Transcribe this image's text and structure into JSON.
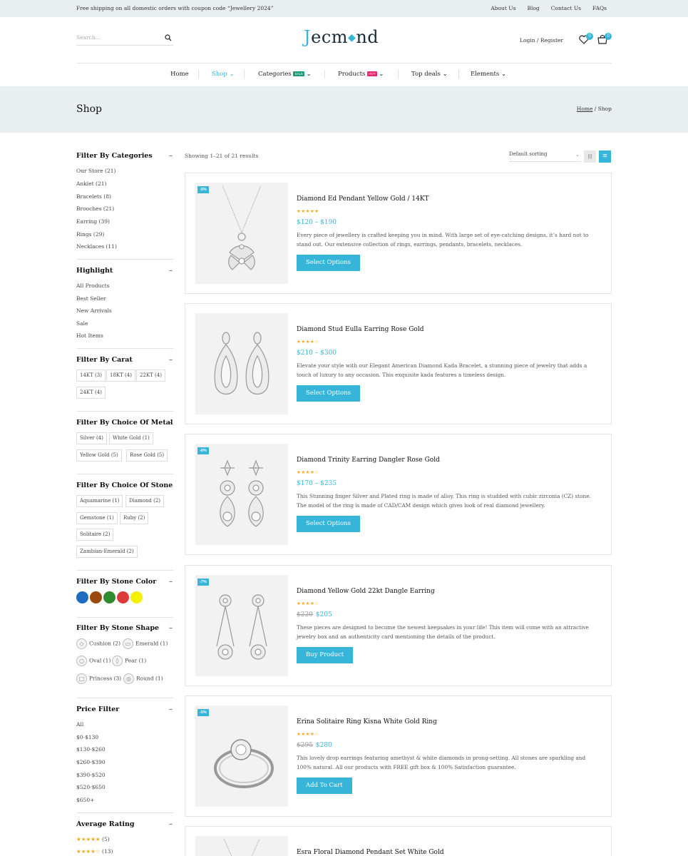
{
  "topbar": {
    "promo": "Free shipping on all domestic orders with coupon code “Jewellery 2024”",
    "links": [
      "About Us",
      "Blog",
      "Contact Us",
      "FAQs"
    ]
  },
  "header": {
    "search_placeholder": "Search...",
    "logo_j": "J",
    "logo_text": "ecm",
    "logo_gem": "◆",
    "logo_end": "nd",
    "login": "Login / Register",
    "wishlist_count": "0",
    "cart_count": "0"
  },
  "nav": {
    "home": "Home",
    "shop": "Shop",
    "categories": "Categories",
    "categories_tag": "SALE",
    "products": "Products",
    "products_tag": "HOT",
    "top_deals": "Top deals",
    "elements": "Elements",
    "chevron": "⌄"
  },
  "banner": {
    "title": "Shop",
    "crumb_home": "Home",
    "crumb_sep": " / ",
    "crumb_current": "Shop"
  },
  "sidebar": {
    "minus": "–",
    "categories": {
      "title": "Filter By Categories",
      "items": [
        "Our Store (21)",
        "Anklet (21)",
        "Bracelets (8)",
        "Brooches (21)",
        "Earring (39)",
        "Rings (29)",
        "Necklaces (11)"
      ]
    },
    "highlight": {
      "title": "Highlight",
      "items": [
        "All Products",
        "Best Seller",
        "New Arrivals",
        "Sale",
        "Hot Items"
      ]
    },
    "carat": {
      "title": "Filter By Carat",
      "chips": [
        "14KT (3)",
        "18KT (4)",
        "22KT (4)",
        "24KT (4)"
      ]
    },
    "metal": {
      "title": "Filter By Choice Of Metal",
      "chips": [
        "Silver (4)",
        "White Gold (1)",
        "Yellow Gold (5)",
        "Rose Gold (5)"
      ]
    },
    "stone": {
      "title": "Filter By Choice Of Stone",
      "chips": [
        "Aquamarine (1)",
        "Diamond (2)",
        "Gemstone (1)",
        "Ruby (2)",
        "Solitaire (2)",
        "Zambian-Emerald (2)"
      ]
    },
    "stone_color": {
      "title": "Filter By Stone Color",
      "colors": [
        "#1f6bc0",
        "#9a4a0c",
        "#2e8b2e",
        "#dc3b3b",
        "#f5f000"
      ]
    },
    "stone_shape": {
      "title": "Filter By Stone Shape",
      "shapes": [
        "Cushion (2)",
        "Emerald (1)",
        "Oval (1)",
        "Pear (1)",
        "Princess (3)",
        "Round (1)"
      ]
    },
    "price": {
      "title": "Price Filter",
      "items": [
        "All",
        "$0-$130",
        "$130-$260",
        "$260-$390",
        "$390-$520",
        "$520-$650",
        "$650+"
      ]
    },
    "rating": {
      "title": "Average Rating",
      "items": [
        {
          "stars": "★★★★★",
          "count": "(5)"
        },
        {
          "stars": "★★★★☆",
          "count": "(13)"
        }
      ]
    }
  },
  "toolbar": {
    "results": "Showing 1–21 of 21 results",
    "sorting": "Default sorting",
    "grid_icon": "|||",
    "list_icon": "≡"
  },
  "products": [
    {
      "badge": "-5%",
      "name": "Diamond Ed Pendant Yellow Gold / 14KT",
      "stars": "★★★★★",
      "old_price": "",
      "price": "$120 – $190",
      "desc": "Every piece of jewellery is crafted keeping you in mind. With large set of eye-catching designs, it’s hard not to stand out. Our extensive collection of rings, earrings, pendants, bracelets, necklaces.",
      "button": "Select Options"
    },
    {
      "badge": "",
      "name": "Diamond Stud Eulla Earring Rose Gold",
      "stars": "★★★★☆",
      "old_price": "",
      "price": "$210 – $300",
      "desc": "Elevate your style with our Elegant American Diamond Kada Bracelet, a stunning piece of jewelry that adds a touch of luxury to any occasion. This exquisite kada features a timeless design.",
      "button": "Select Options"
    },
    {
      "badge": "-6%",
      "name": "Diamond Trinity Earring Dangler Rose Gold",
      "stars": "★★★★☆",
      "old_price": "",
      "price": "$170 – $235",
      "desc": "This Stunning finger Silver and Plated ring is made of alloy. This ring is studded with cubic zirconia (CZ) stone. The model of the ring is made of CAD/CAM design which gives look of real diamond jewellery.",
      "button": "Select Options"
    },
    {
      "badge": "-7%",
      "name": "Diamond Yellow Gold 22kt Dangle Earring",
      "stars": "★★★★☆",
      "old_price": "$220",
      "price": "$205",
      "desc": "These pieces are designed to become the newest keepsakes in your life! This item will come with an attractive jewelry box and an authenticity card mentioning the details of the product.",
      "button": "Buy Product"
    },
    {
      "badge": "-5%",
      "name": "Erina Solitaire Ring Kisna White Gold Ring",
      "stars": "★★★★☆",
      "old_price": "$295",
      "price": "$280",
      "desc": "This lovely drop earrings featuring amethyst & white diamonds in prong-setting. All stones are sparkling and 100% natural. All our products with FREE gift box & 100% Satisfaction guarantee.",
      "button": "Add To Cart"
    },
    {
      "badge": "",
      "name": "Esra Floral Diamond Pendant Set White Gold"
    }
  ]
}
